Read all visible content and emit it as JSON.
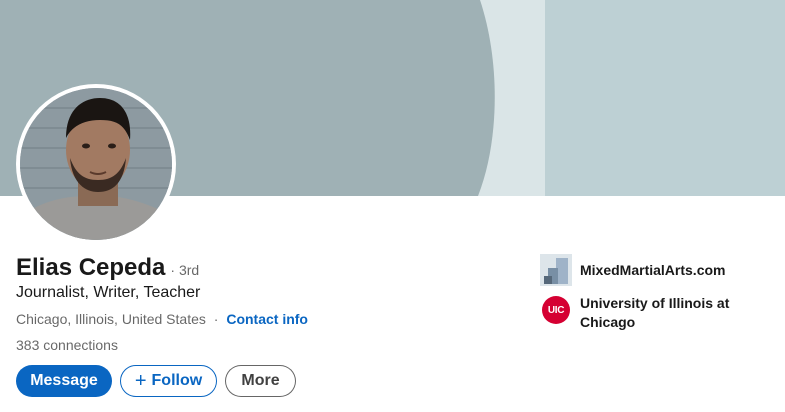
{
  "profile": {
    "name": "Elias Cepeda",
    "degree": "· 3rd",
    "headline": "Journalist, Writer, Teacher",
    "location": "Chicago, Illinois, United States",
    "separator": "·",
    "contact_info_label": "Contact info",
    "connections": "383 connections"
  },
  "actions": {
    "message_label": "Message",
    "follow_label": "Follow",
    "follow_icon": "+",
    "more_label": "More"
  },
  "organizations": [
    {
      "name": "MixedMartialArts.com",
      "logo_icon": "company-logo-icon"
    },
    {
      "name": "University of Illinois at Chicago",
      "logo_text": "UIC",
      "logo_color": "#d50032"
    }
  ],
  "colors": {
    "primary": "#0a66c2",
    "banner_dark": "#9fb1b5",
    "banner_light": "#bdd0d4",
    "banner_mid": "#dae5e7"
  }
}
